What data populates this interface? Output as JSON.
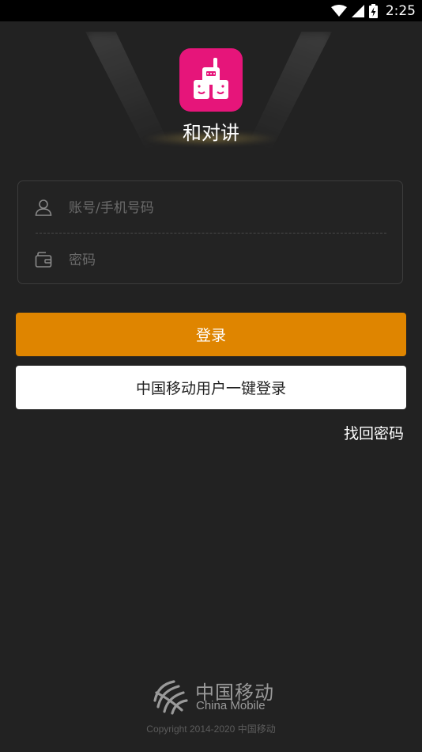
{
  "status_bar": {
    "time": "2:25",
    "icons": [
      "wifi-icon",
      "signal-icon",
      "battery-charging-icon"
    ]
  },
  "app": {
    "name": "和对讲",
    "icon": "walkie-talkie-app-icon",
    "accent_color": "#e6157a"
  },
  "login_form": {
    "account_placeholder": "账号/手机号码",
    "account_value": "",
    "account_icon": "user-icon",
    "password_placeholder": "密码",
    "password_value": "",
    "password_icon": "wallet-lock-icon"
  },
  "buttons": {
    "login_label": "登录",
    "login_color": "#df8500",
    "onekey_login_label": "中国移动用户一键登录",
    "forgot_password_label": "找回密码"
  },
  "footer": {
    "brand_cn": "中国移动",
    "brand_en": "China Mobile",
    "copyright": "Copyright 2014-2020 中国移动"
  }
}
